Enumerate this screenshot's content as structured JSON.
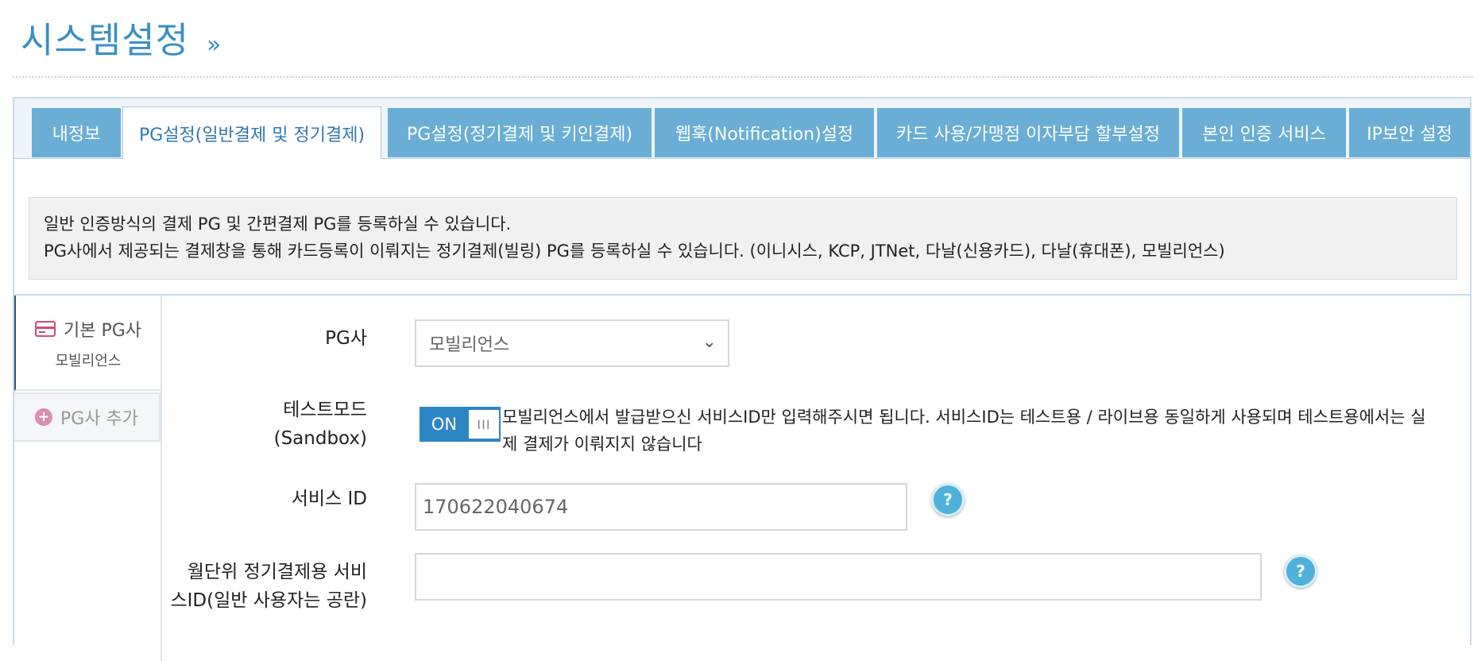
{
  "header": {
    "title": "시스템설정",
    "chevron": "»"
  },
  "tabs": [
    {
      "label": "내정보",
      "active": false
    },
    {
      "label": "PG설정(일반결제 및 정기결제)",
      "active": true
    },
    {
      "label": "PG설정(정기결제 및 키인결제)",
      "active": false
    },
    {
      "label": "웹훅(Notification)설정",
      "active": false
    },
    {
      "label": "카드 사용/가맹점 이자부담 할부설정",
      "active": false
    },
    {
      "label": "본인 인증 서비스",
      "active": false
    },
    {
      "label": "IP보안 설정",
      "active": false
    }
  ],
  "info": {
    "line1": "일반 인증방식의 결제 PG 및 간편결제 PG를 등록하실 수 있습니다.",
    "line2": "PG사에서 제공되는 결제창을 통해 카드등록이 이뤄지는 정기결제(빌링) PG를 등록하실 수 있습니다. (이니시스, KCP, JTNet, 다날(신용카드), 다날(휴대폰), 모빌리언스)"
  },
  "side_nav": {
    "default_pg": {
      "label": "기본 PG사",
      "sub": "모빌리언스",
      "icon": "credit-card-icon"
    },
    "add_pg": {
      "label": "PG사 추가",
      "icon": "plus-circle-icon"
    }
  },
  "form": {
    "pg_label": "PG사",
    "pg_value": "모빌리언스",
    "test_mode_label_1": "테스트모드",
    "test_mode_label_2": "(Sandbox)",
    "toggle_on": "ON",
    "toggle_grip": "III",
    "test_mode_desc": "모빌리언스에서 발급받으신 서비스ID만 입력해주시면 됩니다. 서비스ID는 테스트용 / 라이브용 동일하게 사용되며 테스트용에서는 실제 결제가 이뤄지지 않습니다",
    "service_id_label": "서비스 ID",
    "service_id_value": "170622040674",
    "monthly_id_label_1": "월단위 정기결제용 서비",
    "monthly_id_label_2": "스ID(일반 사용자는 공란)",
    "monthly_id_value": "",
    "help_text": "?"
  },
  "colors": {
    "accent": "#3a8fc4",
    "tab": "#6aaed6",
    "toggle": "#2e85c6",
    "help": "#4fb1d9"
  }
}
